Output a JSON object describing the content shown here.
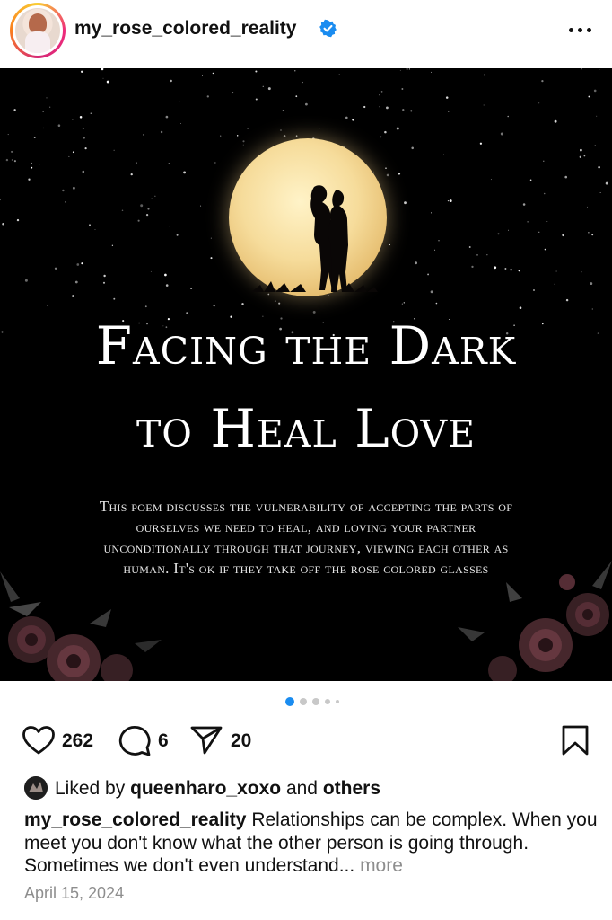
{
  "header": {
    "username": "my_rose_colored_reality",
    "verified": true,
    "more_icon": "ellipsis-icon"
  },
  "post_image": {
    "title_line1": "Facing the Dark",
    "title_line2": "to Heal Love",
    "body_lines": [
      "This poem discusses the vulnerability of accepting the parts of",
      "ourselves we need to heal, and loving your partner",
      "unconditionally through that journey, viewing each other as",
      "human. It's ok if they take off the rose colored glasses"
    ]
  },
  "carousel": {
    "total_dots": 5,
    "active_index": 0,
    "accent": "#1a8cf0"
  },
  "actions": {
    "likes": "262",
    "comments": "6",
    "shares": "20",
    "icons": [
      "heart-icon",
      "comment-icon",
      "share-icon",
      "bookmark-icon"
    ]
  },
  "liked_by": {
    "prefix": "Liked by",
    "user": "queenharo_xoxo",
    "and": "and",
    "others": "others"
  },
  "caption": {
    "username": "my_rose_colored_reality",
    "text": "Relationships can be complex. When you meet you don't know what the other person is going through. Sometimes we don't even understand...",
    "more": "more"
  },
  "date": "April 15, 2024",
  "colors": {
    "verified": "#1a8cf0",
    "muted": "#8e8e8e",
    "text": "#111111"
  }
}
